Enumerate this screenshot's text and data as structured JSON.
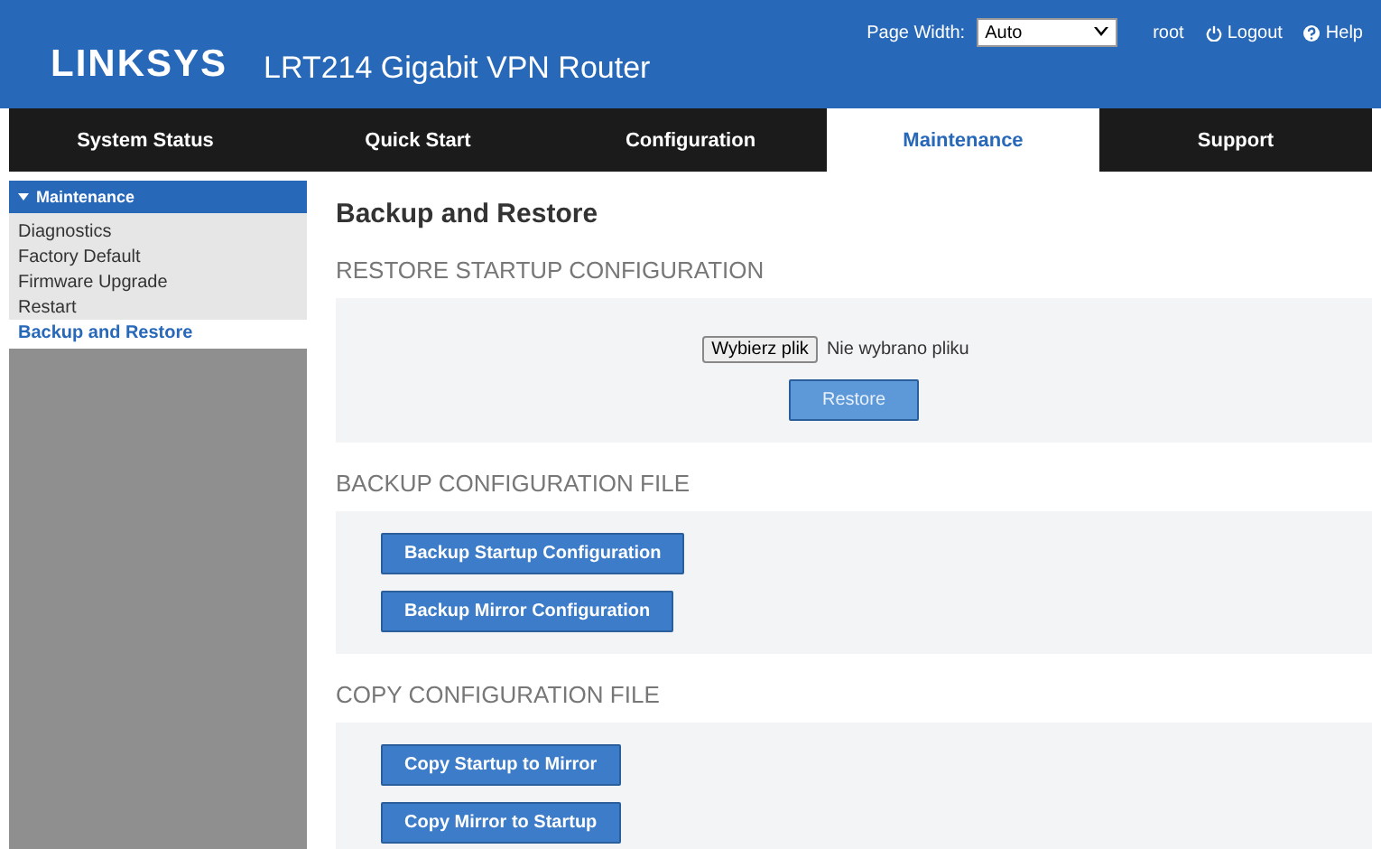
{
  "header": {
    "logo": "LINKSYS",
    "product": "LRT214  Gigabit VPN Router",
    "page_width_label": "Page Width:",
    "page_width_value": "Auto",
    "user": "root",
    "logout": "Logout",
    "help": "Help"
  },
  "tabs": [
    {
      "label": "System Status",
      "selected": false
    },
    {
      "label": "Quick Start",
      "selected": false
    },
    {
      "label": "Configuration",
      "selected": false
    },
    {
      "label": "Maintenance",
      "selected": true
    },
    {
      "label": "Support",
      "selected": false
    }
  ],
  "sidebar": {
    "title": "Maintenance",
    "expanded": true,
    "items": [
      {
        "label": "Diagnostics",
        "selected": false
      },
      {
        "label": "Factory Default",
        "selected": false
      },
      {
        "label": "Firmware Upgrade",
        "selected": false
      },
      {
        "label": "Restart",
        "selected": false
      },
      {
        "label": "Backup and Restore",
        "selected": true
      }
    ]
  },
  "page_title": "Backup and Restore",
  "sections": [
    {
      "heading": "RESTORE STARTUP CONFIGURATION",
      "kind": "restore",
      "file_button": "Wybierz plik",
      "file_status": "Nie wybrano pliku",
      "buttons": [
        {
          "label": "Restore",
          "disabled": true
        }
      ]
    },
    {
      "heading": "BACKUP CONFIGURATION FILE",
      "kind": "buttons",
      "buttons": [
        {
          "label": "Backup Startup Configuration",
          "disabled": false
        },
        {
          "label": "Backup Mirror Configuration",
          "disabled": false
        }
      ]
    },
    {
      "heading": "COPY CONFIGURATION FILE",
      "kind": "buttons",
      "buttons": [
        {
          "label": "Copy Startup to Mirror",
          "disabled": false
        },
        {
          "label": "Copy Mirror to Startup",
          "disabled": false
        }
      ]
    }
  ]
}
